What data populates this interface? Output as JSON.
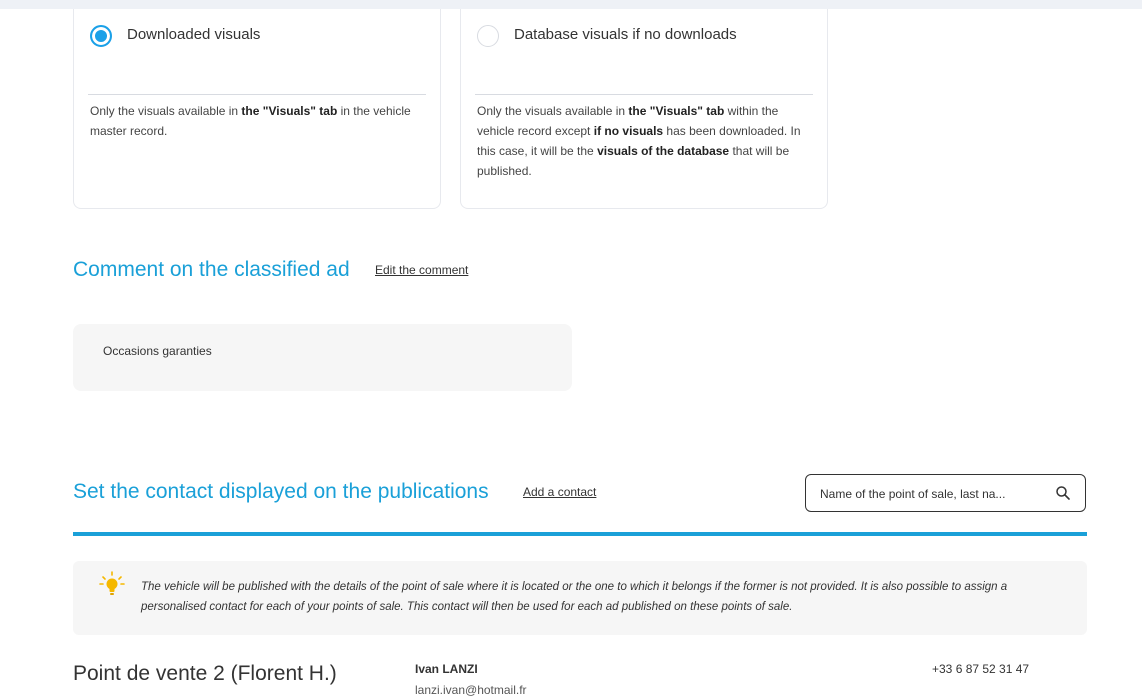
{
  "visuals_options": [
    {
      "label": "Downloaded visuals",
      "selected": true,
      "desc_parts": [
        {
          "text": "Only the visuals available in ",
          "bold": false
        },
        {
          "text": "the \"Visuals\" tab",
          "bold": true
        },
        {
          "text": " in the vehicle master record.",
          "bold": false
        }
      ]
    },
    {
      "label": "Database visuals if no downloads",
      "selected": false,
      "desc_parts": [
        {
          "text": "Only the visuals available in ",
          "bold": false
        },
        {
          "text": "the \"Visuals\" tab",
          "bold": true
        },
        {
          "text": " within the vehicle record except ",
          "bold": false
        },
        {
          "text": "if no visuals",
          "bold": true
        },
        {
          "text": " has been downloaded. In this case, it will be the ",
          "bold": false
        },
        {
          "text": "visuals of the database",
          "bold": true
        },
        {
          "text": " that will be published.",
          "bold": false
        }
      ]
    }
  ],
  "comment_section": {
    "title": "Comment on the classified ad",
    "edit_link": "Edit the comment",
    "comment_text": "Occasions garanties"
  },
  "contact_section": {
    "title": "Set the contact displayed on the publications",
    "add_link": "Add a contact",
    "search_placeholder": "Name of the point of sale, last na...",
    "info_text": "The vehicle will be published with the details of the point of sale where it is located or the one to which it belongs if the former is not provided. It is also possible to assign a personalised contact for each of your points of sale. This contact will then be used for each ad published on these points of sale."
  },
  "contacts": [
    {
      "point_of_sale": "Point de vente 2 (Florent H.)",
      "name": "Ivan LANZI",
      "email": "lanzi.ivan@hotmail.fr",
      "phone": "+33 6 87 52 31 47"
    }
  ],
  "colors": {
    "accent": "#1aa0d8",
    "radio_selected": "#1aa0e8",
    "panel_bg": "#f6f6f6",
    "bulb": "#f5b800"
  },
  "icons": {
    "search": "search-icon",
    "bulb": "lightbulb-icon"
  }
}
